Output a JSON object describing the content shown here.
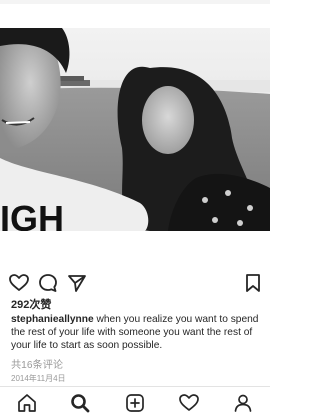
{
  "post": {
    "likes": "292次赞",
    "username": "stephanieallynne",
    "caption": " when you realize you want to spend the rest of your life with someone you want the rest of your life to start as soon possible.",
    "comments": "共16条评论",
    "date": "2014年11月4日",
    "shirt_text": "IGH"
  },
  "icons": {
    "like": "heart-icon",
    "comment": "comment-bubble-icon",
    "share": "send-arrow-icon",
    "save": "bookmark-icon",
    "home": "home-icon",
    "search": "search-icon",
    "add": "plus-square-icon",
    "activity": "heart-icon",
    "profile": "profile-icon"
  },
  "colors": {
    "text": "#262626",
    "muted": "#999999",
    "divider": "#e3e3e3"
  }
}
